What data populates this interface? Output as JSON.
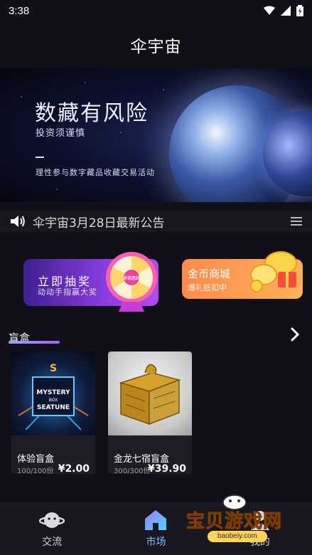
{
  "status_bar": {
    "time": "3:38",
    "icons": [
      "wifi-icon",
      "signal-icon",
      "battery-icon"
    ]
  },
  "app_bar": {
    "title": "伞宇宙"
  },
  "banner": {
    "headline": "数藏有风险",
    "subline": "投资须谨慎",
    "note": "理性参与数字藏品收藏交易活动"
  },
  "notice": {
    "text": "伞宇宙3月28日最新公告",
    "icon": "speaker-icon",
    "menu_icon": "menu-icon"
  },
  "promos": {
    "lottery": {
      "title": "立即抽奖",
      "subtitle": "动动手指赢大奖",
      "wheel_text": "谢谢惠顾"
    },
    "coin_mall": {
      "title": "金币商城",
      "subtitle": "爆礼抵扣中"
    }
  },
  "section": {
    "label": "盲盒",
    "more_icon": "chevron-right-icon"
  },
  "cards": [
    {
      "name": "体验盲盒",
      "stock": "100/100份",
      "price": "¥2.00",
      "image_text": [
        "MYSTERY",
        "BOX",
        "SEATUNE"
      ]
    },
    {
      "name": "金龙七宿盲盒",
      "stock": "300/300份",
      "price": "¥39.90"
    }
  ],
  "tabs": [
    {
      "label": "交流",
      "icon": "planet-icon",
      "active": false
    },
    {
      "label": "市场",
      "icon": "house-icon",
      "active": true
    },
    {
      "label": "我的",
      "icon": "user-icon",
      "active": false
    }
  ],
  "watermark": {
    "text": "宝贝游戏网",
    "url": "baobeiy.com"
  },
  "colors": {
    "accent": "#6ec1ff",
    "background": "#111018",
    "promo_purple": "#8a3ce0",
    "promo_orange": "#ff9a52"
  }
}
